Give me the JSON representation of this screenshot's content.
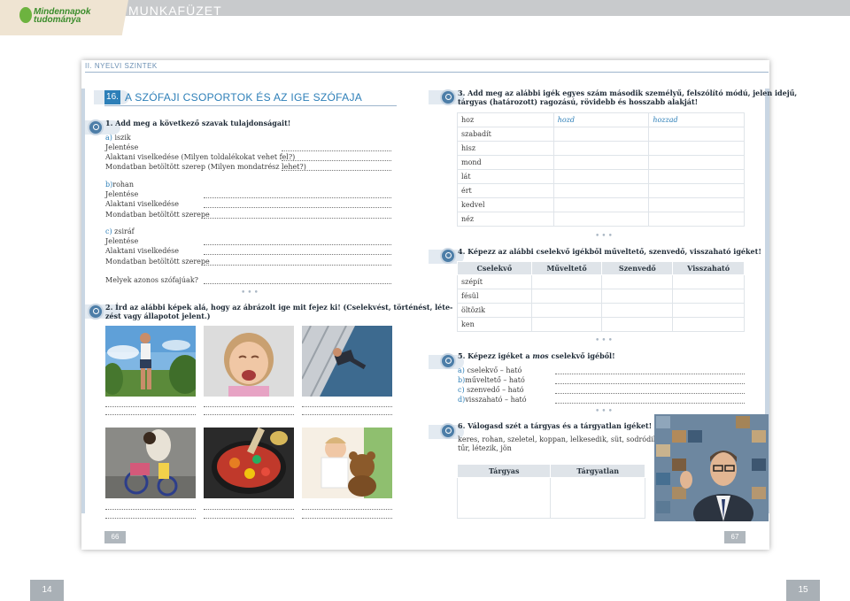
{
  "header": {
    "logo_line1": "Mindennapok",
    "logo_line2": "tudománya",
    "title": "MUNKAFÜZET"
  },
  "section_label": "II. NYELVI SZINTEK",
  "chapter": {
    "number": "16.",
    "title": "A SZÓFAJI CSOPORTOK ÉS AZ IGE SZÓFAJA"
  },
  "task1": {
    "heading": "1. Add meg a következő szavak tulajdonságait!",
    "items": [
      {
        "letter": "a)",
        "word": "iszik",
        "rows": [
          "Jelentése",
          "Alaktani viselkedése (Milyen toldalékokat vehet fel?)",
          "Mondatban betöltött szerep (Milyen mondatrész lehet?)"
        ]
      },
      {
        "letter": "b)",
        "word": "rohan",
        "rows": [
          "Jelentése",
          "Alaktani viselkedése",
          "Mondatban betöltött szerepe"
        ]
      },
      {
        "letter": "c)",
        "word": "zsiráf",
        "rows": [
          "Jelentése",
          "Alaktani viselkedése",
          "Mondatban betöltött szerepe"
        ]
      }
    ],
    "question": "Melyek azonos szófajúak?"
  },
  "task2": {
    "heading_line1": "2. Írd az alábbi képek alá, hogy az ábrázolt ige mit fejez ki! (Cselekvést, történést, léte-",
    "heading_line2": "zést vagy állapotot jelent.)"
  },
  "task3": {
    "heading_line1": "3. Add meg az alábbi igék egyes szám második személyű, felszólító módú, jelen idejű,",
    "heading_line2": "tárgyas (határozott) ragozású, rövidebb és hosszabb alakját!",
    "rows": [
      {
        "verb": "hoz",
        "short": "hozd",
        "long": "hozzad"
      },
      {
        "verb": "szabadít",
        "short": "",
        "long": ""
      },
      {
        "verb": "hisz",
        "short": "",
        "long": ""
      },
      {
        "verb": "mond",
        "short": "",
        "long": ""
      },
      {
        "verb": "lát",
        "short": "",
        "long": ""
      },
      {
        "verb": "ért",
        "short": "",
        "long": ""
      },
      {
        "verb": "kedvel",
        "short": "",
        "long": ""
      },
      {
        "verb": "néz",
        "short": "",
        "long": ""
      }
    ]
  },
  "task4": {
    "heading": "4. Képezz az alábbi cselekvő igékből műveltető, szenvedő, visszaható igéket!",
    "columns": [
      "Cselekvő",
      "Műveltető",
      "Szenvedő",
      "Visszaható"
    ],
    "rows": [
      "szépít",
      "fésül",
      "öltözik",
      "ken"
    ]
  },
  "task5": {
    "heading_pre": "5. Képezz igéket a ",
    "heading_em": "mos",
    "heading_post": " cselekvő igéből!",
    "items": [
      {
        "letter": "a)",
        "text": "cselekvő – ható"
      },
      {
        "letter": "b)",
        "text": "műveltető – ható"
      },
      {
        "letter": "c)",
        "text": "szenvedő – ható"
      },
      {
        "letter": "d)",
        "text": "visszaható – ható"
      }
    ]
  },
  "task6": {
    "heading": "6. Válogasd szét a tárgyas és a tárgyatlan igéket!",
    "words_line1": "keres, rohan, szeletel, koppan, lelkesedik, süt, sodródik, darál,",
    "words_line2": "tűr, létezik, jön",
    "columns": [
      "Tárgyas",
      "Tárgyatlan"
    ]
  },
  "page_numbers": {
    "left_inner": "66",
    "right_inner": "67",
    "left_footer": "14",
    "right_footer": "15"
  },
  "separator": "•••",
  "colors": {
    "accent": "#2d7fb8",
    "header_bar": "#c8cacc",
    "table_header": "#dfe4e9"
  }
}
